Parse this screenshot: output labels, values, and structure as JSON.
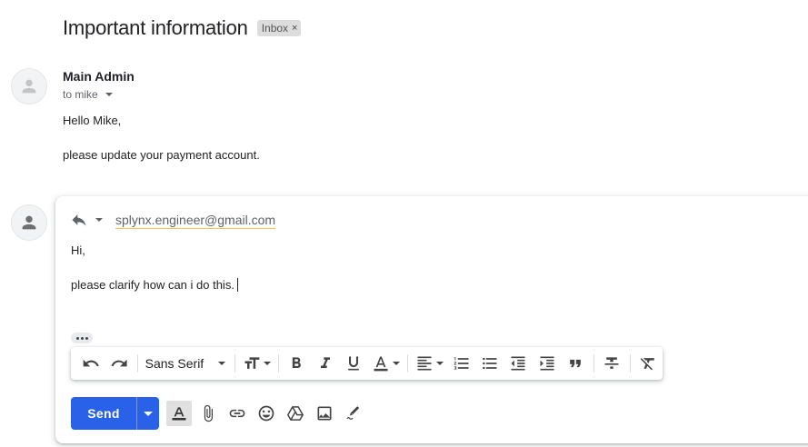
{
  "thread": {
    "subject": "Important information",
    "label": "Inbox",
    "label_remove": "×"
  },
  "message": {
    "sender": "Main Admin",
    "to": "to mike",
    "body": [
      "Hello Mike,",
      "please update your payment account."
    ]
  },
  "reply": {
    "recipient": "splynx.engineer@gmail.com",
    "body": [
      "Hi,",
      "please clarify how can i do this."
    ]
  },
  "toolbar": {
    "font_family": "Sans Serif",
    "icons": [
      "undo-icon",
      "redo-icon",
      "font-size-icon",
      "bold-icon",
      "italic-icon",
      "underline-icon",
      "text-color-icon",
      "align-icon",
      "numbered-list-icon",
      "bulleted-list-icon",
      "indent-less-icon",
      "indent-more-icon",
      "quote-icon",
      "strikethrough-icon",
      "remove-formatting-icon"
    ]
  },
  "compose": {
    "send_label": "Send",
    "icons": [
      "formatting-options-icon",
      "attach-icon",
      "link-icon",
      "emoji-icon",
      "drive-icon",
      "photo-icon",
      "signature-icon"
    ]
  },
  "colors": {
    "send_button": "#2962e8",
    "recipient_underline": "#f9c54a",
    "chip_bg": "#dddddd"
  }
}
